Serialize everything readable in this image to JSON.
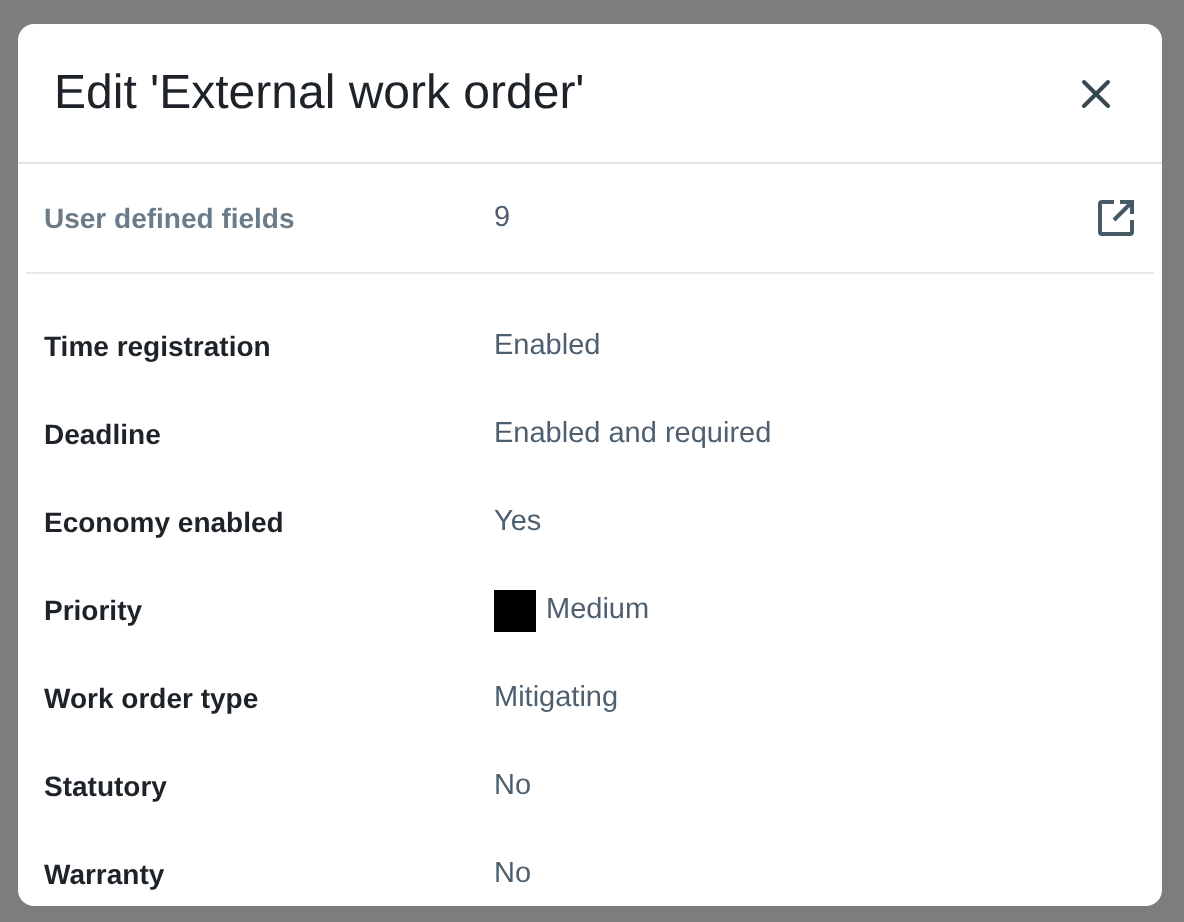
{
  "dialog": {
    "title": "Edit 'External work order'",
    "summary": {
      "label": "User defined fields",
      "value": "9"
    },
    "fields": [
      {
        "label": "Time registration",
        "value": "Enabled"
      },
      {
        "label": "Deadline",
        "value": "Enabled and required"
      },
      {
        "label": "Economy enabled",
        "value": "Yes"
      },
      {
        "label": "Priority",
        "value": "Medium",
        "color": "#000000"
      },
      {
        "label": "Work order type",
        "value": "Mitigating"
      },
      {
        "label": "Statutory",
        "value": "No"
      },
      {
        "label": "Warranty",
        "value": "No"
      }
    ]
  }
}
